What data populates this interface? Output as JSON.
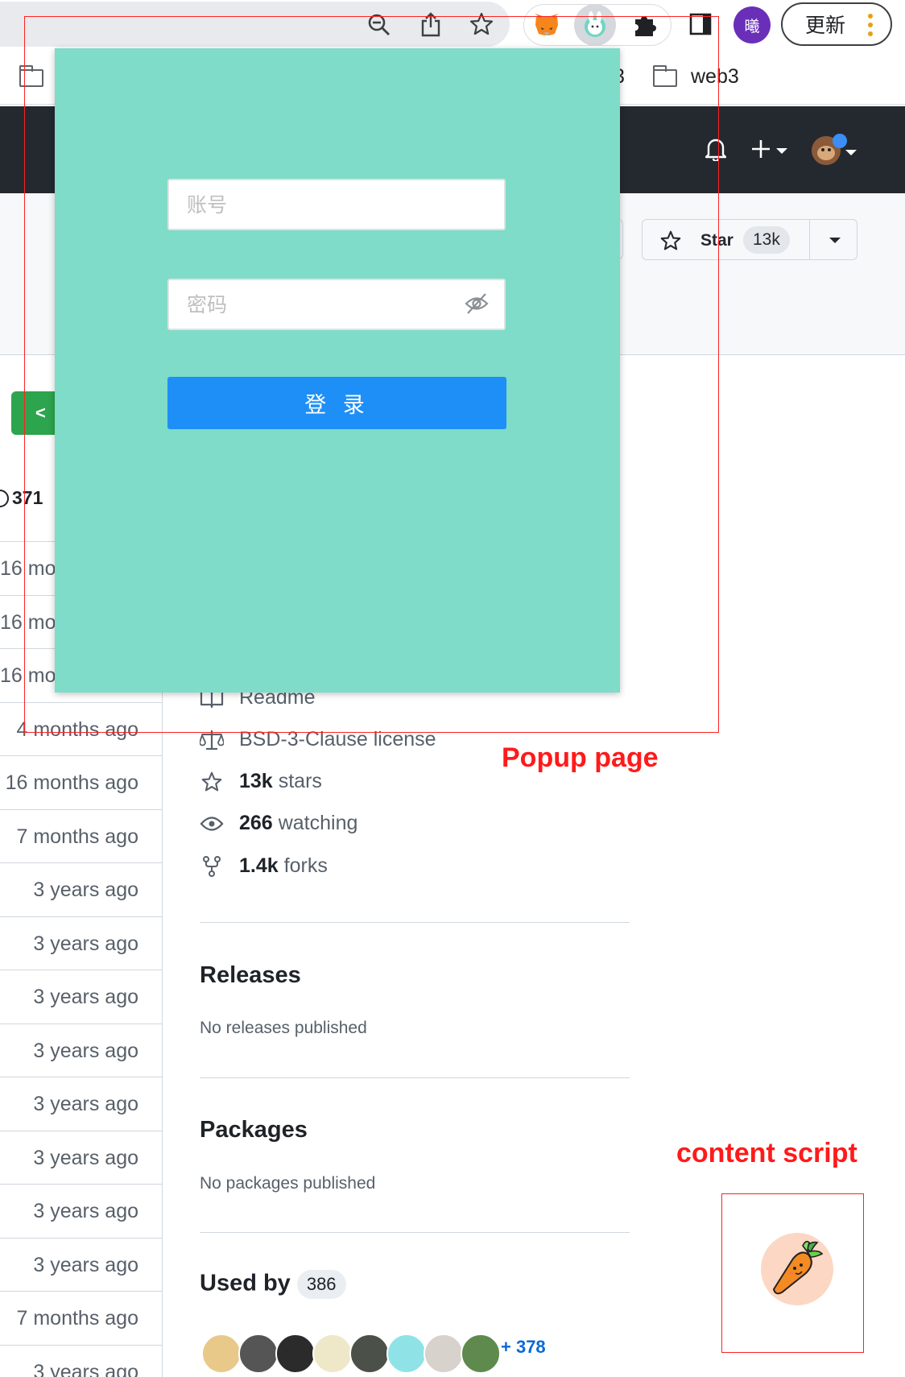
{
  "browser": {
    "profile_initial": "曦",
    "update_label": "更新",
    "bookmarks": [
      "3",
      "web3"
    ]
  },
  "repo": {
    "star_label": "Star",
    "star_count": "13k",
    "commit_count": "371",
    "file_times": [
      "16 mo",
      "16 mo",
      "16 mo",
      "4 months ago",
      "16 months ago",
      "7 months ago",
      "3 years ago",
      "3 years ago",
      "3 years ago",
      "3 years ago",
      "3 years ago",
      "3 years ago",
      "3 years ago",
      "3 years ago",
      "7 months ago",
      "3 years ago"
    ],
    "about": {
      "readme": "Readme",
      "license": "BSD-3-Clause license",
      "stars_value": "13k",
      "stars_label": "stars",
      "watching_value": "266",
      "watching_label": "watching",
      "forks_value": "1.4k",
      "forks_label": "forks"
    },
    "releases": {
      "title": "Releases",
      "note": "No releases published"
    },
    "packages": {
      "title": "Packages",
      "note": "No packages published"
    },
    "used_by": {
      "title": "Used by",
      "count": "386",
      "more": "+ 378"
    }
  },
  "popup": {
    "account_placeholder": "账号",
    "password_placeholder": "密码",
    "login_label": "登 录",
    "background": "#7edcc8",
    "button_color": "#1e8ff7"
  },
  "annotations": {
    "popup_page": "Popup page",
    "content_script": "content script",
    "color": "#ff1a1a"
  }
}
